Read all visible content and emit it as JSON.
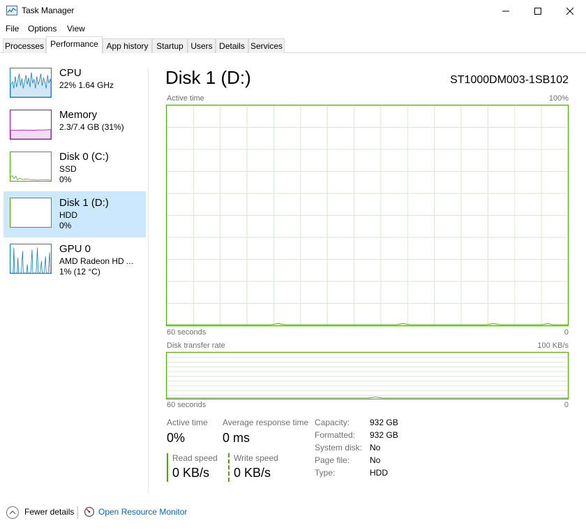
{
  "window": {
    "title": "Task Manager"
  },
  "menu": [
    "File",
    "Options",
    "View"
  ],
  "tabs": [
    "Processes",
    "Performance",
    "App history",
    "Startup",
    "Users",
    "Details",
    "Services"
  ],
  "sidebar": [
    {
      "name": "CPU",
      "sub1": "22%  1.64 GHz",
      "sub2": "",
      "color": "#117dbb"
    },
    {
      "name": "Memory",
      "sub1": "2.3/7.4 GB (31%)",
      "sub2": "",
      "color": "#8b12ae"
    },
    {
      "name": "Disk 0 (C:)",
      "sub1": "SSD",
      "sub2": "0%",
      "color": "#4da60c"
    },
    {
      "name": "Disk 1 (D:)",
      "sub1": "HDD",
      "sub2": "0%",
      "color": "#4da60c"
    },
    {
      "name": "GPU 0",
      "sub1": "AMD Radeon HD ...",
      "sub2": "1%  (12 °C)",
      "color": "#117dbb"
    }
  ],
  "main": {
    "title": "Disk 1 (D:)",
    "model": "ST1000DM003-1SB102",
    "active_graph": {
      "label": "Active time",
      "max": "100%",
      "time": "60 seconds",
      "min": "0"
    },
    "transfer_graph": {
      "label": "Disk transfer rate",
      "max": "100 KB/s",
      "time": "60 seconds",
      "min": "0"
    }
  },
  "stats": {
    "active_time_label": "Active time",
    "active_time_value": "0%",
    "avg_response_label": "Average response time",
    "avg_response_value": "0 ms",
    "read_speed_label": "Read speed",
    "read_speed_value": "0 KB/s",
    "write_speed_label": "Write speed",
    "write_speed_value": "0 KB/s"
  },
  "properties": [
    {
      "label": "Capacity:",
      "value": "932 GB"
    },
    {
      "label": "Formatted:",
      "value": "932 GB"
    },
    {
      "label": "System disk:",
      "value": "No"
    },
    {
      "label": "Page file:",
      "value": "No"
    },
    {
      "label": "Type:",
      "value": "HDD"
    }
  ],
  "footer": {
    "fewer_details": "Fewer details",
    "resource_monitor": "Open Resource Monitor"
  },
  "colors": {
    "disk_green": "#4da60c",
    "selected_bg": "#cce8ff",
    "link": "#0066cc"
  }
}
